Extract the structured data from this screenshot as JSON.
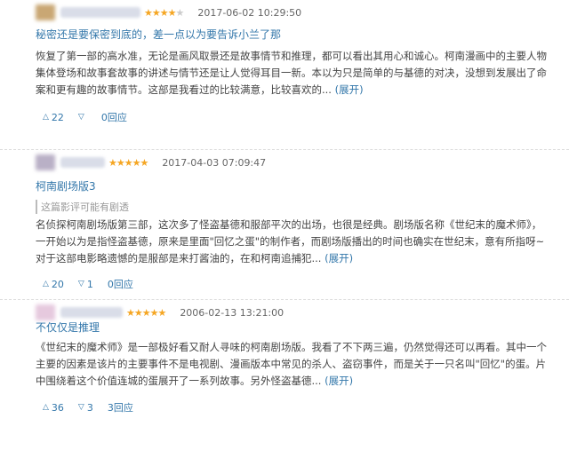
{
  "reviews": [
    {
      "avatar_color": "#c9a774",
      "stars": 4,
      "date": "2017-06-02 10:29:50",
      "title": "秘密还是要保密到底的，差一点以为要告诉小兰了那",
      "spoiler": "",
      "body": "恢复了第一部的高水准，无论是画风取景还是故事情节和推理，都可以看出其用心和诚心。柯南漫画中的主要人物集体登场和故事套故事的讲述与情节还是让人觉得耳目一新。本以为只是简单的与基德的对决，没想到发展出了命案和更有趣的故事情节。这部是我看过的比较满意，比较喜欢的...",
      "expand": "(展开)",
      "up": "22",
      "down": "",
      "reply": "0回应"
    },
    {
      "avatar_color": "#b9b0c6",
      "stars": 5,
      "date": "2017-04-03 07:09:47",
      "title": "柯南剧场版3",
      "spoiler": "这篇影评可能有剧透",
      "body": "名侦探柯南剧场版第三部，这次多了怪盗基德和服部平次的出场，也很是经典。剧场版名称《世纪末的魔术师》，一开始以为是指怪盗基德，原来是里面\"回忆之蛋\"的制作者，而剧场版播出的时间也确实在世纪末，意有所指呀~ 对于这部电影略遗憾的是服部是来打酱油的，在和柯南追捕犯...",
      "expand": "(展开)",
      "up": "20",
      "down": "1",
      "reply": "0回应"
    },
    {
      "avatar_color": "#e6c9de",
      "stars": 5,
      "date": "2006-02-13 13:21:00",
      "title": "不仅仅是推理",
      "spoiler": "",
      "body": "《世纪末的魔术师》是一部极好看又耐人寻味的柯南剧场版。我看了不下两三遍，仍然觉得还可以再看。其中一个主要的因素是该片的主要事件不是电视剧、漫画版本中常见的杀人、盗窃事件，而是关于一只名叫\"回忆\"的蛋。片中围绕着这个价值连城的蛋展开了一系列故事。另外怪盗基德...",
      "expand": "(展开)",
      "up": "36",
      "down": "3",
      "reply": "3回应"
    }
  ]
}
